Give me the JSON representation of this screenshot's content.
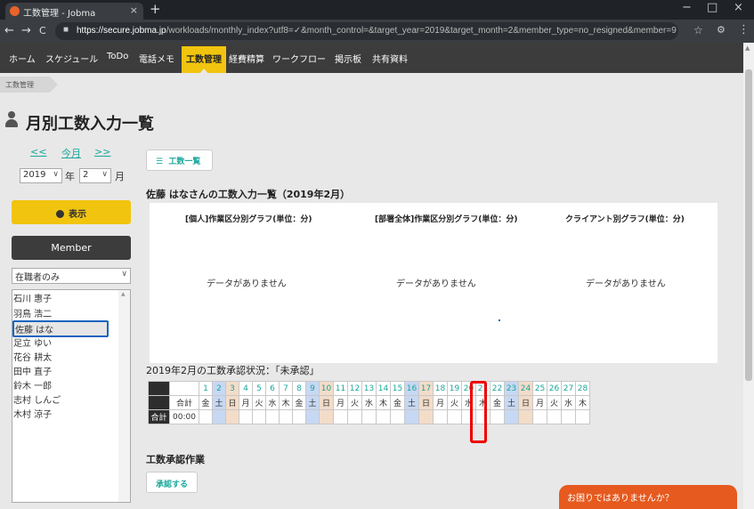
{
  "browser": {
    "tab_title": "工数管理 - Jobma",
    "tab_close": "×",
    "new_tab": "+",
    "window_controls": [
      "−",
      "□",
      "×"
    ],
    "nav": {
      "back": "←",
      "forward": "→",
      "reload": "C"
    },
    "url_host": "https://secure.jobma.jp",
    "url_path": "/workloads/monthly_index?utf8=✓&month_control=&target_year=2019&target_month=2&member_type=no_resigned&member=9"
  },
  "app_nav": [
    "ホーム",
    "スケジュール",
    "ToDo",
    "電話メモ",
    "工数管理",
    "経費精算",
    "ワークフロー",
    "掲示板",
    "共有資料"
  ],
  "active_nav": "工数管理",
  "breadcrumb": "工数管理",
  "page_title": "月別工数入力一覧",
  "month_nav": {
    "prev": "<<",
    "current": "今月",
    "next": ">>"
  },
  "filters": {
    "year": "2019",
    "year_unit": "年",
    "month": "2",
    "month_unit": "月",
    "member_type": "在職者のみ"
  },
  "show_button": "表示",
  "member_button": "Member",
  "members": [
    "石川 惠子",
    "羽鳥 浩二",
    "佐藤 はな",
    "足立 ゆい",
    "花谷 耕太",
    "田中 直子",
    "鈴木 一郎",
    "志村 しんご",
    "木村 涼子"
  ],
  "selected_member": "佐藤 はな",
  "list_button": "工数一覧",
  "list_title": "佐藤 はなさんの工数入力一覧（2019年2月）",
  "graphs": [
    {
      "title": "[個人]作業区分別グラフ(単位：分)",
      "empty": "データがありません"
    },
    {
      "title": "[部署全体]作業区分別グラフ(単位：分)",
      "empty": "データがありません"
    },
    {
      "title": "クライアント別グラフ(単位：分)",
      "empty": "データがありません"
    }
  ],
  "approval_status": "2019年2月の工数承認状況：「未承認」",
  "calendar": {
    "total_label": "合計",
    "row_label": "合計",
    "total_value": "00:00",
    "days": [
      "1",
      "2",
      "3",
      "4",
      "5",
      "6",
      "7",
      "8",
      "9",
      "10",
      "11",
      "12",
      "13",
      "14",
      "15",
      "16",
      "17",
      "18",
      "19",
      "20",
      "21",
      "22",
      "23",
      "24",
      "25",
      "26",
      "27",
      "28"
    ],
    "weekdays": [
      "金",
      "土",
      "日",
      "月",
      "火",
      "水",
      "木",
      "金",
      "土",
      "日",
      "月",
      "火",
      "水",
      "木",
      "金",
      "土",
      "日",
      "月",
      "火",
      "水",
      "木",
      "金",
      "土",
      "日",
      "月",
      "火",
      "水",
      "木"
    ]
  },
  "approval_section": "工数承認作業",
  "approve_button": "承認する",
  "help_chip": "お困りではありませんか？",
  "colors": {
    "accent": "#f1c40f",
    "teal": "#1aa79a",
    "saturday": "#c6d8f3",
    "sunday": "#f3dcc8",
    "highlight": "#e00000",
    "help": "#e65a1f"
  }
}
